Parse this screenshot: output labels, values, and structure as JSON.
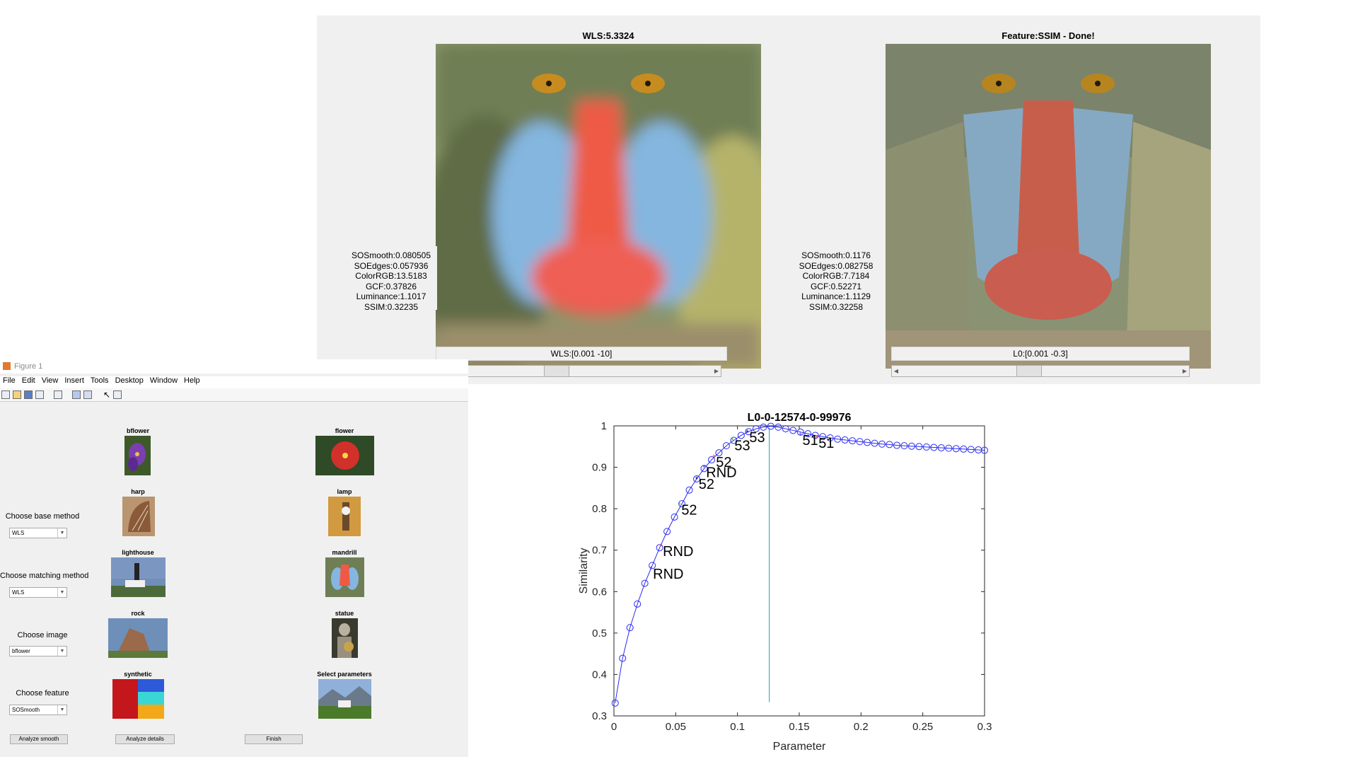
{
  "top_figure": {
    "left": {
      "title": "WLS:5.3324",
      "stats": [
        "SOSmooth:0.080505",
        "SOEdges:0.057936",
        "ColorRGB:13.5183",
        "GCF:0.37826",
        "Luminance:1.1017",
        "SSIM:0.32235"
      ],
      "param_label": "WLS:[0.001 -10]",
      "slider_value": 0.43
    },
    "right": {
      "title": "Feature:SSIM - Done!",
      "stats": [
        "SOSmooth:0.1176",
        "SOEdges:0.082758",
        "ColorRGB:7.7184",
        "GCF:0.52271",
        "Luminance:1.1129",
        "SSIM:0.32258"
      ],
      "param_label": "L0:[0.001 -0.3]",
      "slider_value": 0.45
    }
  },
  "figure_window": {
    "title": "Figure 1",
    "menu": [
      "File",
      "Edit",
      "View",
      "Insert",
      "Tools",
      "Desktop",
      "Window",
      "Help"
    ],
    "toolbar_icons": [
      "new-file-icon",
      "open-folder-icon",
      "save-icon",
      "print-icon",
      "print-preview-icon",
      "insert-colorbar-icon",
      "insert-legend-icon",
      "pointer-icon",
      "property-editor-icon"
    ],
    "images": [
      {
        "caption": "bflower"
      },
      {
        "caption": "flower"
      },
      {
        "caption": "harp"
      },
      {
        "caption": "lamp"
      },
      {
        "caption": "lighthouse"
      },
      {
        "caption": "mandrill"
      },
      {
        "caption": "rock"
      },
      {
        "caption": "statue"
      },
      {
        "caption": "synthetic"
      },
      {
        "caption": "Select parameters"
      }
    ],
    "controls": [
      {
        "label": "Choose base method",
        "value": "WLS"
      },
      {
        "label": "Choose matching method",
        "value": "WLS"
      },
      {
        "label": "Choose image",
        "value": "bflower"
      },
      {
        "label": "Choose feature",
        "value": "SOSmooth"
      }
    ],
    "buttons": {
      "analyze_smooth": "Analyze smooth",
      "analyze_details": "Analyze details",
      "finish": "Finish"
    }
  },
  "chart_data": {
    "type": "line",
    "title": "L0-0-12574-0-99976",
    "xlabel": "Parameter",
    "ylabel": "Similarity",
    "xlim": [
      0,
      0.3
    ],
    "ylim": [
      0.3,
      1
    ],
    "xticks": [
      "0",
      "0.05",
      "0.1",
      "0.15",
      "0.2",
      "0.25",
      "0.3"
    ],
    "yticks": [
      "0.3",
      "0.4",
      "0.5",
      "0.6",
      "0.7",
      "0.8",
      "0.9",
      "1"
    ],
    "vline_x": 0.12574,
    "series": [
      {
        "x": [
          0.001,
          0.007,
          0.013,
          0.019,
          0.025,
          0.031,
          0.037,
          0.043,
          0.049,
          0.055,
          0.061,
          0.067,
          0.073,
          0.079,
          0.085,
          0.091,
          0.097,
          0.103,
          0.109,
          0.115,
          0.121,
          0.127,
          0.133,
          0.139,
          0.145,
          0.151,
          0.157,
          0.163,
          0.169,
          0.175,
          0.181,
          0.187,
          0.193,
          0.199,
          0.205,
          0.211,
          0.217,
          0.223,
          0.229,
          0.235,
          0.241,
          0.247,
          0.253,
          0.259,
          0.265,
          0.271,
          0.277,
          0.283,
          0.289,
          0.295,
          0.3
        ],
        "y": [
          0.331,
          0.439,
          0.513,
          0.57,
          0.62,
          0.663,
          0.706,
          0.745,
          0.78,
          0.812,
          0.845,
          0.872,
          0.897,
          0.918,
          0.935,
          0.952,
          0.965,
          0.977,
          0.986,
          0.993,
          0.997,
          0.999,
          0.997,
          0.993,
          0.989,
          0.985,
          0.981,
          0.977,
          0.974,
          0.971,
          0.968,
          0.966,
          0.964,
          0.962,
          0.96,
          0.958,
          0.956,
          0.955,
          0.953,
          0.952,
          0.951,
          0.95,
          0.949,
          0.948,
          0.947,
          0.946,
          0.945,
          0.944,
          0.943,
          0.942,
          0.941
        ]
      }
    ],
    "annotations": [
      {
        "text": "RND",
        "x": 0.031,
        "y": 0.655
      },
      {
        "text": "RND",
        "x": 0.039,
        "y": 0.71
      },
      {
        "text": "52",
        "x": 0.054,
        "y": 0.81
      },
      {
        "text": "52",
        "x": 0.068,
        "y": 0.872
      },
      {
        "text": "RND",
        "x": 0.074,
        "y": 0.9
      },
      {
        "text": "52",
        "x": 0.082,
        "y": 0.925
      },
      {
        "text": "53",
        "x": 0.097,
        "y": 0.965
      },
      {
        "text": "53",
        "x": 0.109,
        "y": 0.985
      },
      {
        "text": "51",
        "x": 0.152,
        "y": 0.978
      },
      {
        "text": "51",
        "x": 0.165,
        "y": 0.971
      }
    ],
    "marker_colors": [
      "#4040ff",
      "#ff4040",
      "#40c040",
      "#000080"
    ]
  }
}
